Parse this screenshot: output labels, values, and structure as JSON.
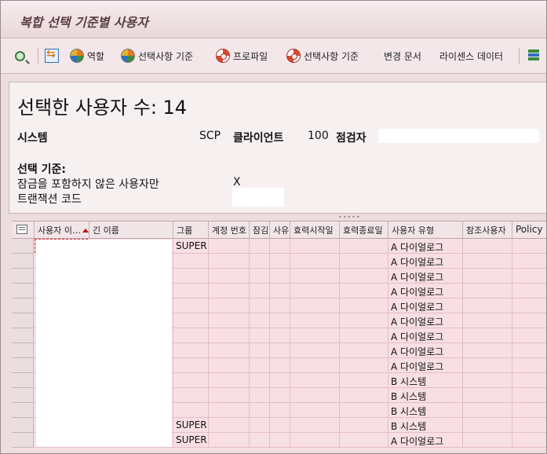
{
  "window": {
    "title": "복합 선택 기준별 사용자"
  },
  "toolbar": {
    "role_label": "역할",
    "criteria1_label": "선택사항 기준",
    "profile_label": "프로파일",
    "criteria2_label": "선택사항 기준",
    "change_docs_label": "변경 문서",
    "license_label": "라이센스 데이터"
  },
  "summary": {
    "heading": "선택한 사용자 수: 14",
    "system_label": "시스템",
    "system_value": "SCP",
    "client_label": "클라이언트",
    "client_value": "100",
    "checker_label": "점검자",
    "criteria_label": "선택 기준:",
    "unlocked_label": "잠금을 포함하지 않은 사용자만",
    "unlocked_value": "X",
    "tcode_label": "트랜잭션 코드"
  },
  "grid": {
    "columns": [
      "사용자 이…",
      "긴 이름",
      "그룹",
      "계정 번호",
      "잠김",
      "사유",
      "효력시작일",
      "효력종료일",
      "사용자 유형",
      "참조사용자",
      "Policy"
    ],
    "rows": [
      {
        "group": "SUPER",
        "type": "A 다이얼로그"
      },
      {
        "group": "",
        "type": "A 다이얼로그"
      },
      {
        "group": "",
        "type": "A 다이얼로그"
      },
      {
        "group": "",
        "type": "A 다이얼로그"
      },
      {
        "group": "",
        "type": "A 다이얼로그"
      },
      {
        "group": "",
        "type": "A 다이얼로그"
      },
      {
        "group": "",
        "type": "A 다이얼로그"
      },
      {
        "group": "",
        "type": "A 다이얼로그"
      },
      {
        "group": "",
        "type": "A 다이얼로그"
      },
      {
        "group": "",
        "type": "B 시스템"
      },
      {
        "group": "",
        "type": "B 시스템"
      },
      {
        "group": "",
        "type": "B 시스템"
      },
      {
        "group": "SUPER",
        "type": "B 시스템"
      },
      {
        "group": "SUPER",
        "type": "A 다이얼로그"
      }
    ]
  }
}
